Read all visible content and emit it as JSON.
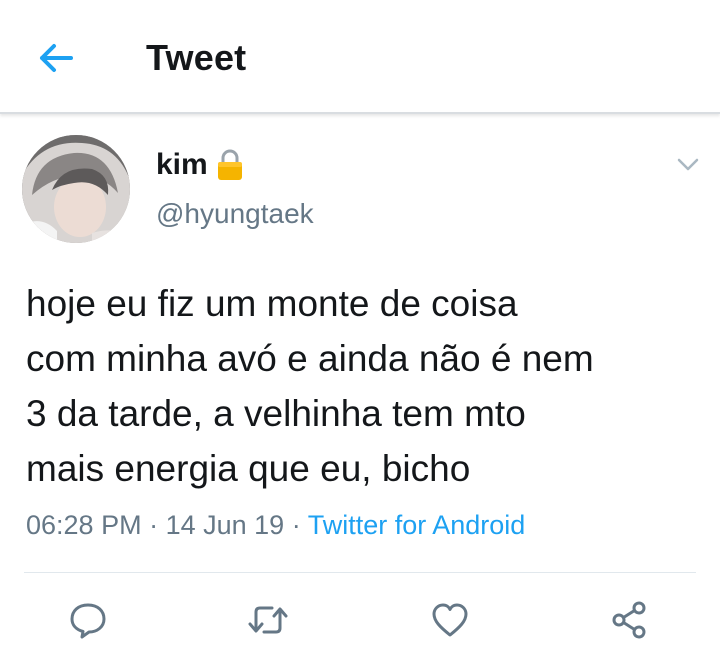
{
  "header": {
    "title": "Tweet",
    "back_icon": "arrow-left-icon"
  },
  "tweet": {
    "author": {
      "name": "kim",
      "handle": "@hyungtaek",
      "protected_icon": "lock-icon"
    },
    "text": "hoje eu fiz um monte de coisa\ncom minha avó e ainda não é nem\n3 da tarde, a velhinha tem mto\nmais energia que eu, bicho",
    "time": "06:28 PM",
    "date": "14 Jun 19",
    "separator": " · ",
    "source": "Twitter for Android"
  },
  "actions": [
    {
      "name": "reply",
      "icon": "reply-icon"
    },
    {
      "name": "retweet",
      "icon": "retweet-icon"
    },
    {
      "name": "like",
      "icon": "heart-icon"
    },
    {
      "name": "share",
      "icon": "share-icon"
    }
  ],
  "colors": {
    "accent": "#1da1f2",
    "text": "#14171a",
    "secondary_text": "#657786",
    "lock": "#f5b400"
  }
}
